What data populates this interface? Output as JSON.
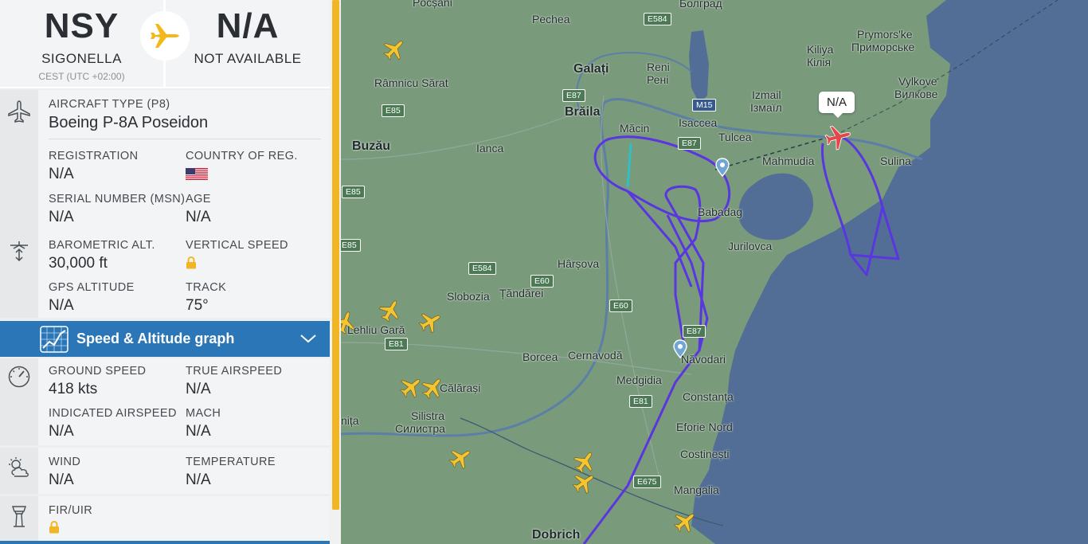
{
  "route": {
    "origin": {
      "code": "NSY",
      "city": "SIGONELLA",
      "timezone": "CEST (UTC +02:00)"
    },
    "destination": {
      "code": "N/A",
      "city": "NOT AVAILABLE"
    }
  },
  "aircraft": {
    "type_label": "AIRCRAFT TYPE",
    "type_code": "(P8)",
    "type_name": "Boeing P-8A Poseidon",
    "registration_label": "REGISTRATION",
    "registration": "N/A",
    "country_label": "COUNTRY OF REG.",
    "country_flag": "us-flag",
    "serial_label": "SERIAL NUMBER (MSN)",
    "serial": "N/A",
    "age_label": "AGE",
    "age": "N/A"
  },
  "altitude": {
    "baro_label": "BAROMETRIC ALT.",
    "baro": "30,000 ft",
    "vs_label": "VERTICAL SPEED",
    "vs_locked": true,
    "gps_label": "GPS ALTITUDE",
    "gps": "N/A",
    "track_label": "TRACK",
    "track": "75°"
  },
  "graph": {
    "label": "Speed & Altitude graph"
  },
  "speed": {
    "ground_label": "GROUND SPEED",
    "ground": "418 kts",
    "true_label": "TRUE AIRSPEED",
    "true": "N/A",
    "ias_label": "INDICATED AIRSPEED",
    "ias": "N/A",
    "mach_label": "MACH",
    "mach": "N/A"
  },
  "weather": {
    "wind_label": "WIND",
    "wind": "N/A",
    "temp_label": "TEMPERATURE",
    "temp": "N/A"
  },
  "fir": {
    "label": "FIR/UIR",
    "locked": true
  },
  "map": {
    "selected_callout": "N/A",
    "colors": {
      "land": "#7a9a7c",
      "sea": "#536e96",
      "track": "#5a36e0",
      "selected_aircraft": "#e4474a",
      "aircraft": "#f4c531"
    },
    "places": [
      {
        "id": "pocsani",
        "name": "Pocșani"
      },
      {
        "id": "pechea",
        "name": "Pechea"
      },
      {
        "id": "bolgrad",
        "name": "Болград"
      },
      {
        "id": "galati",
        "name": "Galați"
      },
      {
        "id": "reni",
        "name": "Reni"
      },
      {
        "id": "reni2",
        "name": "Рені"
      },
      {
        "id": "kiliya",
        "name": "Kiliya"
      },
      {
        "id": "kiliya2",
        "name": "Кілія"
      },
      {
        "id": "prymorske",
        "name": "Prymors'ke"
      },
      {
        "id": "prymorske2",
        "name": "Приморське"
      },
      {
        "id": "ramnicu",
        "name": "Râmnicu Sărat"
      },
      {
        "id": "izmail",
        "name": "Izmail"
      },
      {
        "id": "izmail2",
        "name": "Ізмаїл"
      },
      {
        "id": "vylkove",
        "name": "Vylkove"
      },
      {
        "id": "vylkove2",
        "name": "Вилкове"
      },
      {
        "id": "braila",
        "name": "Brăila"
      },
      {
        "id": "macin",
        "name": "Măcin"
      },
      {
        "id": "isaccea",
        "name": "Isaccea"
      },
      {
        "id": "tulcea",
        "name": "Tulcea"
      },
      {
        "id": "buzau",
        "name": "Buzău"
      },
      {
        "id": "ianca",
        "name": "Ianca"
      },
      {
        "id": "mahmudia",
        "name": "Mahmudia"
      },
      {
        "id": "sulina",
        "name": "Sulina"
      },
      {
        "id": "babadag",
        "name": "Babadag"
      },
      {
        "id": "jurilovca",
        "name": "Jurilovca"
      },
      {
        "id": "harsova",
        "name": "Hârșova"
      },
      {
        "id": "slobozia",
        "name": "Slobozia"
      },
      {
        "id": "tandarei",
        "name": "Țăndărei"
      },
      {
        "id": "lehliu",
        "name": "Lehliu Gară"
      },
      {
        "id": "borcea",
        "name": "Borcea"
      },
      {
        "id": "cernavoda",
        "name": "Cernavodă"
      },
      {
        "id": "navodari",
        "name": "Năvodari"
      },
      {
        "id": "calarasi",
        "name": "Călărași"
      },
      {
        "id": "medgidia",
        "name": "Medgidia"
      },
      {
        "id": "constanta",
        "name": "Constanța"
      },
      {
        "id": "oltenita",
        "name": "nița"
      },
      {
        "id": "silistra",
        "name": "Silistra"
      },
      {
        "id": "silistra2",
        "name": "Силистра"
      },
      {
        "id": "eforie",
        "name": "Eforie Nord"
      },
      {
        "id": "costinesti",
        "name": "Costinești"
      },
      {
        "id": "mangalia",
        "name": "Mangalia"
      },
      {
        "id": "dobrich",
        "name": "Dobrich"
      }
    ],
    "roads": [
      "E584",
      "M15",
      "E87",
      "E85",
      "E87",
      "E85",
      "E85",
      "E584",
      "E60",
      "E60",
      "E81",
      "E87",
      "E81",
      "E675"
    ]
  }
}
